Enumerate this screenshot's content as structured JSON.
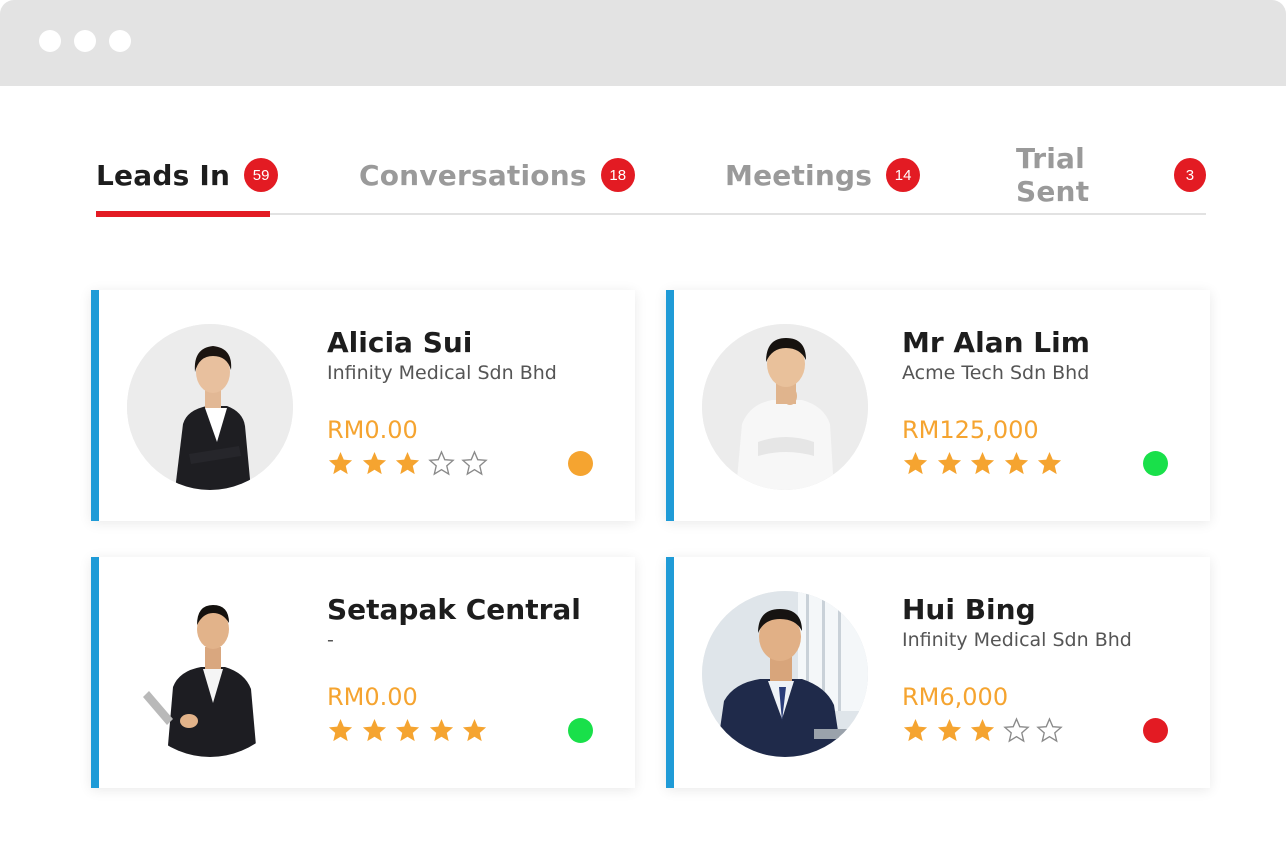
{
  "tabs": [
    {
      "label": "Leads In",
      "count": "59"
    },
    {
      "label": "Conversations",
      "count": "18"
    },
    {
      "label": "Meetings",
      "count": "14"
    },
    {
      "label": "Trial Sent",
      "count": "3"
    }
  ],
  "colors": {
    "accent_red": "#e31b23",
    "card_border_blue": "#1f9bd7",
    "amount_orange": "#f5a430",
    "status_orange": "#f5a430",
    "status_green": "#19e04a",
    "status_red": "#e31b23"
  },
  "leads": [
    {
      "name": "Alicia Sui",
      "company": "Infinity Medical Sdn Bhd",
      "amount": "RM0.00",
      "rating": 3,
      "rating_max": 5,
      "status_color": "#f5a430",
      "avatar_icon": "woman-business-portrait"
    },
    {
      "name": "Mr Alan Lim",
      "company": "Acme Tech Sdn Bhd",
      "amount": "RM125,000",
      "rating": 5,
      "rating_max": 5,
      "status_color": "#19e04a",
      "avatar_icon": "man-business-portrait"
    },
    {
      "name": "Setapak Central",
      "company": "-",
      "amount": "RM0.00",
      "rating": 5,
      "rating_max": 5,
      "status_color": "#19e04a",
      "avatar_icon": "man-suit-tablet-portrait"
    },
    {
      "name": "Hui Bing",
      "company": "Infinity Medical Sdn Bhd",
      "amount": "RM6,000",
      "rating": 3,
      "rating_max": 5,
      "status_color": "#e31b23",
      "avatar_icon": "man-office-portrait"
    }
  ]
}
